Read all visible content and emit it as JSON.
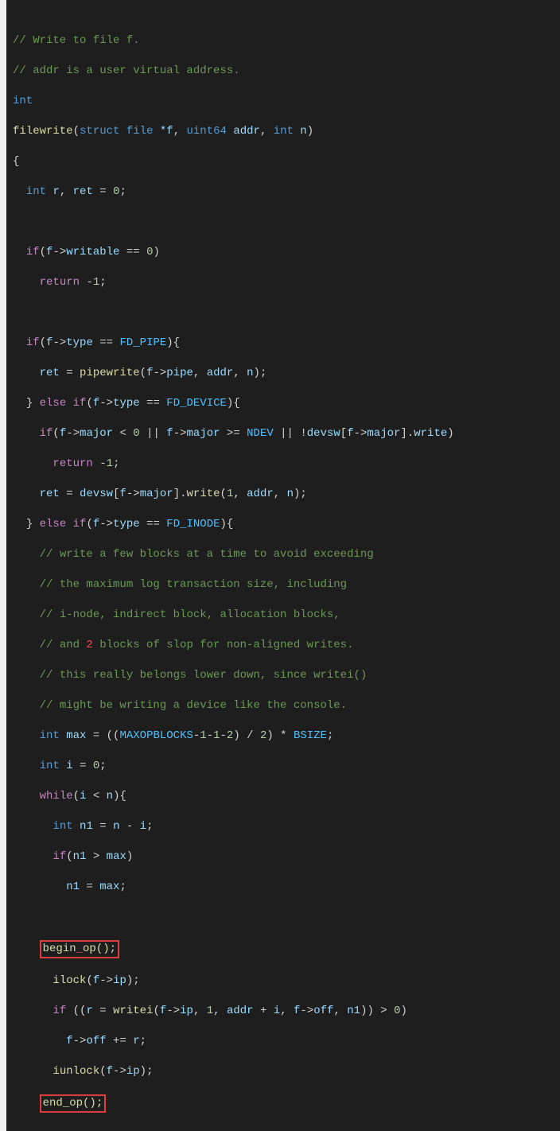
{
  "code": {
    "c1": "// Write to file f.",
    "c2": "// addr is a user virtual address.",
    "t_int": "int",
    "fn": "filewrite",
    "t_struct": "struct",
    "t_file": "file",
    "p_f": "*f",
    "t_u64": "uint64",
    "p_addr": "addr",
    "p_n": "n",
    "decl_r": "r",
    "decl_ret": "ret",
    "zero": "0",
    "one": "1",
    "two": "2",
    "neg1": "-1",
    "kw_if": "if",
    "kw_else": "else",
    "kw_return": "return",
    "kw_while": "while",
    "f_arrow": "f->",
    "writable": "writable",
    "type": "type",
    "pipe": "pipe",
    "major": "major",
    "ip": "ip",
    "off": "off",
    "FD_PIPE": "FD_PIPE",
    "FD_DEVICE": "FD_DEVICE",
    "FD_INODE": "FD_INODE",
    "NDEV": "NDEV",
    "devsw": "devsw",
    "write": "write",
    "pipewrite": "pipewrite",
    "addr": "addr",
    "n": "n",
    "ret": "ret",
    "r": "r",
    "cmt_w1": "// write a few blocks at a time to avoid exceeding",
    "cmt_w2": "// the maximum log transaction size, including",
    "cmt_w3": "// i-node, indirect block, allocation blocks,",
    "cmt_w4a": "// and ",
    "cmt_w4b": " blocks of slop for non-aligned writes.",
    "cmt_w5": "// this really belongs lower down, since writei()",
    "cmt_w6": "// might be writing a device like the console.",
    "max": "max",
    "MAXOPBLOCKS": "MAXOPBLOCKS",
    "BSIZE": "BSIZE",
    "i": "i",
    "n1": "n1",
    "begin_partial": "begin",
    "begin_rest": "op();",
    "ilock": "ilock",
    "iunlock": "iunlock",
    "writei": "writei",
    "end_op": "end_op();",
    "underscore": "_"
  }
}
